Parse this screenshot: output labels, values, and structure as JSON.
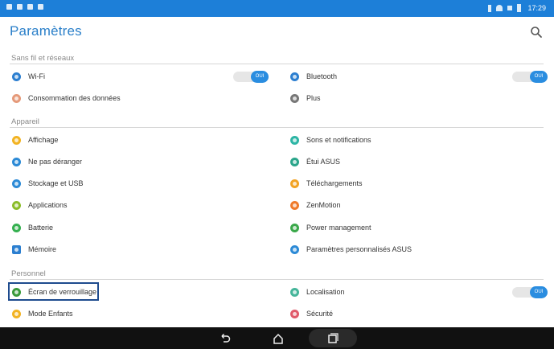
{
  "header": {
    "title": "Paramètres",
    "search_icon": "search-icon"
  },
  "status_bar": {
    "time": "17:29",
    "accent": "#1d7fd8"
  },
  "sections": {
    "wireless": "Sans fil et réseaux",
    "device": "Appareil",
    "personal": "Personnel"
  },
  "wireless": {
    "left": [
      {
        "label": "Wi-Fi",
        "icon": "wifi-icon",
        "color": "#2c7fd0"
      },
      {
        "label": "Consommation des données",
        "icon": "data-usage-icon",
        "color": "#e59a7a"
      }
    ],
    "right": [
      {
        "label": "Bluetooth",
        "icon": "bluetooth-icon",
        "color": "#2c7fd0"
      },
      {
        "label": "Plus",
        "icon": "more-icon",
        "color": "#777777"
      }
    ],
    "wifi_toggle": "OUI",
    "bluetooth_toggle": "OUI"
  },
  "device": {
    "left": [
      {
        "label": "Affichage",
        "icon": "display-icon",
        "color": "#f2b323"
      },
      {
        "label": "Ne pas déranger",
        "icon": "do-not-disturb-icon",
        "color": "#2c8ad6"
      },
      {
        "label": "Stockage et USB",
        "icon": "storage-icon",
        "color": "#2c8ad6"
      },
      {
        "label": "Applications",
        "icon": "apps-icon",
        "color": "#8bbd2a"
      },
      {
        "label": "Batterie",
        "icon": "battery-icon",
        "color": "#35b050"
      },
      {
        "label": "Mémoire",
        "icon": "memory-icon",
        "color": "#2c7fd0"
      }
    ],
    "right": [
      {
        "label": "Sons et notifications",
        "icon": "sound-icon",
        "color": "#2db5a5"
      },
      {
        "label": "Étui ASUS",
        "icon": "asus-cover-icon",
        "color": "#2aa58a"
      },
      {
        "label": "Téléchargements",
        "icon": "downloads-icon",
        "color": "#f2a324"
      },
      {
        "label": "ZenMotion",
        "icon": "zenmotion-icon",
        "color": "#ef7a2a"
      },
      {
        "label": "Power management",
        "icon": "power-management-icon",
        "color": "#3aa84a"
      },
      {
        "label": "Paramètres personnalisés ASUS",
        "icon": "asus-settings-icon",
        "color": "#2c8ad6"
      }
    ]
  },
  "personal": {
    "left": [
      {
        "label": "Écran de verrouillage",
        "icon": "lock-screen-icon",
        "color": "#3a9a3a"
      },
      {
        "label": "Mode Enfants",
        "icon": "kids-mode-icon",
        "color": "#f2b323"
      }
    ],
    "right": [
      {
        "label": "Localisation",
        "icon": "location-icon",
        "color": "#45b59a"
      },
      {
        "label": "Sécurité",
        "icon": "security-icon",
        "color": "#e05a6a"
      }
    ],
    "location_toggle": "OUI"
  },
  "nav": {
    "back": "back-icon",
    "home": "home-icon",
    "recents": "recents-icon"
  }
}
